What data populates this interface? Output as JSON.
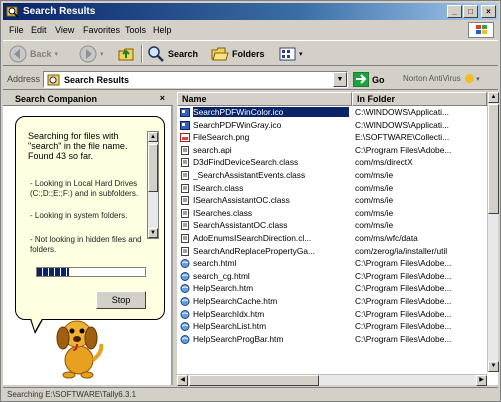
{
  "window": {
    "title": "Search Results",
    "minimize_glyph": "_",
    "maximize_glyph": "□",
    "close_glyph": "×"
  },
  "menu": [
    "File",
    "Edit",
    "View",
    "Favorites",
    "Tools",
    "Help"
  ],
  "toolbar": {
    "back": "Back",
    "search": "Search",
    "folders": "Folders"
  },
  "address": {
    "label": "Address",
    "value": "Search Results",
    "go": "Go",
    "norton": "Norton AntiVirus"
  },
  "companion": {
    "header": "Search Companion",
    "close": "×",
    "message": "Searching for files with \"search\" in the file name. Found 43 so far.",
    "items": [
      "- Looking in Local Hard Drives (C:;D:;E:;F:) and in subfolders.",
      "- Looking in system folders.",
      "- Not looking in hidden files and folders."
    ],
    "progress": 0.3,
    "stop": "Stop"
  },
  "columns": {
    "name": "Name",
    "folder": "In Folder"
  },
  "files": [
    {
      "name": "SearchPDFWinColor.ico",
      "folder": "C:\\WINDOWS\\Applicati...",
      "icon": "ico",
      "selected": true
    },
    {
      "name": "SearchPDFWinGray.ico",
      "folder": "C:\\WINDOWS\\Applicati...",
      "icon": "ico",
      "selected": false
    },
    {
      "name": "FileSearch.png",
      "folder": "E:\\SOFTWARE\\Collecti...",
      "icon": "png",
      "selected": false
    },
    {
      "name": "search.api",
      "folder": "C:\\Program Files\\Adobe...",
      "icon": "file",
      "selected": false
    },
    {
      "name": "D3dFindDeviceSearch.class",
      "folder": "com/ms/directX",
      "icon": "file",
      "selected": false
    },
    {
      "name": "_SearchAssistantEvents.class",
      "folder": "com/ms/ie",
      "icon": "file",
      "selected": false
    },
    {
      "name": "ISearch.class",
      "folder": "com/ms/ie",
      "icon": "file",
      "selected": false
    },
    {
      "name": "ISearchAssistantOC.class",
      "folder": "com/ms/ie",
      "icon": "file",
      "selected": false
    },
    {
      "name": "ISearches.class",
      "folder": "com/ms/ie",
      "icon": "file",
      "selected": false
    },
    {
      "name": "SearchAssistantOC.class",
      "folder": "com/ms/ie",
      "icon": "file",
      "selected": false
    },
    {
      "name": "AdoEnumsISearchDirection.cl...",
      "folder": "com/ms/wfc/data",
      "icon": "file",
      "selected": false
    },
    {
      "name": "SearchAndReplacePropertyGa...",
      "folder": "com/zerog/ia/installer/util",
      "icon": "file",
      "selected": false
    },
    {
      "name": "search.html",
      "folder": "C:\\Program Files\\Adobe...",
      "icon": "html",
      "selected": false
    },
    {
      "name": "search_cg.html",
      "folder": "C:\\Program Files\\Adobe...",
      "icon": "html",
      "selected": false
    },
    {
      "name": "HelpSearch.htm",
      "folder": "C:\\Program Files\\Adobe...",
      "icon": "html",
      "selected": false
    },
    {
      "name": "HelpSearchCache.htm",
      "folder": "C:\\Program Files\\Adobe...",
      "icon": "html",
      "selected": false
    },
    {
      "name": "HelpSearchIdx.htm",
      "folder": "C:\\Program Files\\Adobe...",
      "icon": "html",
      "selected": false
    },
    {
      "name": "HelpSearchList.htm",
      "folder": "C:\\Program Files\\Adobe...",
      "icon": "html",
      "selected": false
    },
    {
      "name": "HelpSearchProgBar.htm",
      "folder": "C:\\Program Files\\Adobe...",
      "icon": "html",
      "selected": false
    }
  ],
  "status": "Searching E:\\SOFTWARE\\Tally6.3.1",
  "icons": {
    "app": "search-results-icon",
    "back": "back-arrow-icon",
    "forward": "forward-arrow-icon",
    "up": "up-folder-icon",
    "search": "search-icon",
    "folders": "folders-icon",
    "views": "views-icon",
    "go": "go-arrow-icon",
    "dog": "rover-dog-icon"
  },
  "colors": {
    "title_bar": "#0a246a",
    "selection": "#0a246a",
    "chrome": "#d4d0c8",
    "tooltip": "#ffffe1"
  }
}
